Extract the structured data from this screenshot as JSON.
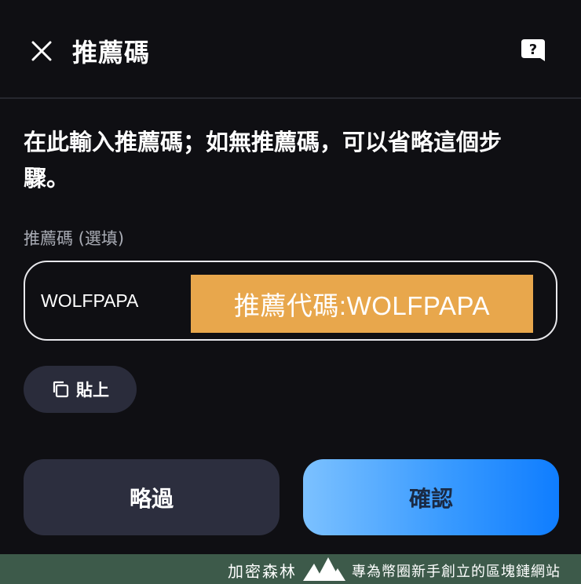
{
  "header": {
    "title": "推薦碼",
    "close_icon": "close-icon",
    "help_icon": "help-chat-icon"
  },
  "instruction": "在此輸入推薦碼；如無推薦碼，可以省略這個步驟。",
  "referral": {
    "field_label": "推薦碼 (選填)",
    "value": "WOLFPAPA",
    "overlay_banner": "推薦代碼:WOLFPAPA",
    "overlay_color": "#e8a74c"
  },
  "paste": {
    "label": "貼上",
    "icon": "copy-icon"
  },
  "actions": {
    "skip_label": "略過",
    "confirm_label": "確認",
    "confirm_gradient": [
      "#7cc1ff",
      "#0f7dff"
    ]
  },
  "watermark": {
    "site_name": "加密森林",
    "tagline": "專為幣圈新手創立的區塊鏈網站",
    "logo_icon": "mountain-logo-icon"
  }
}
